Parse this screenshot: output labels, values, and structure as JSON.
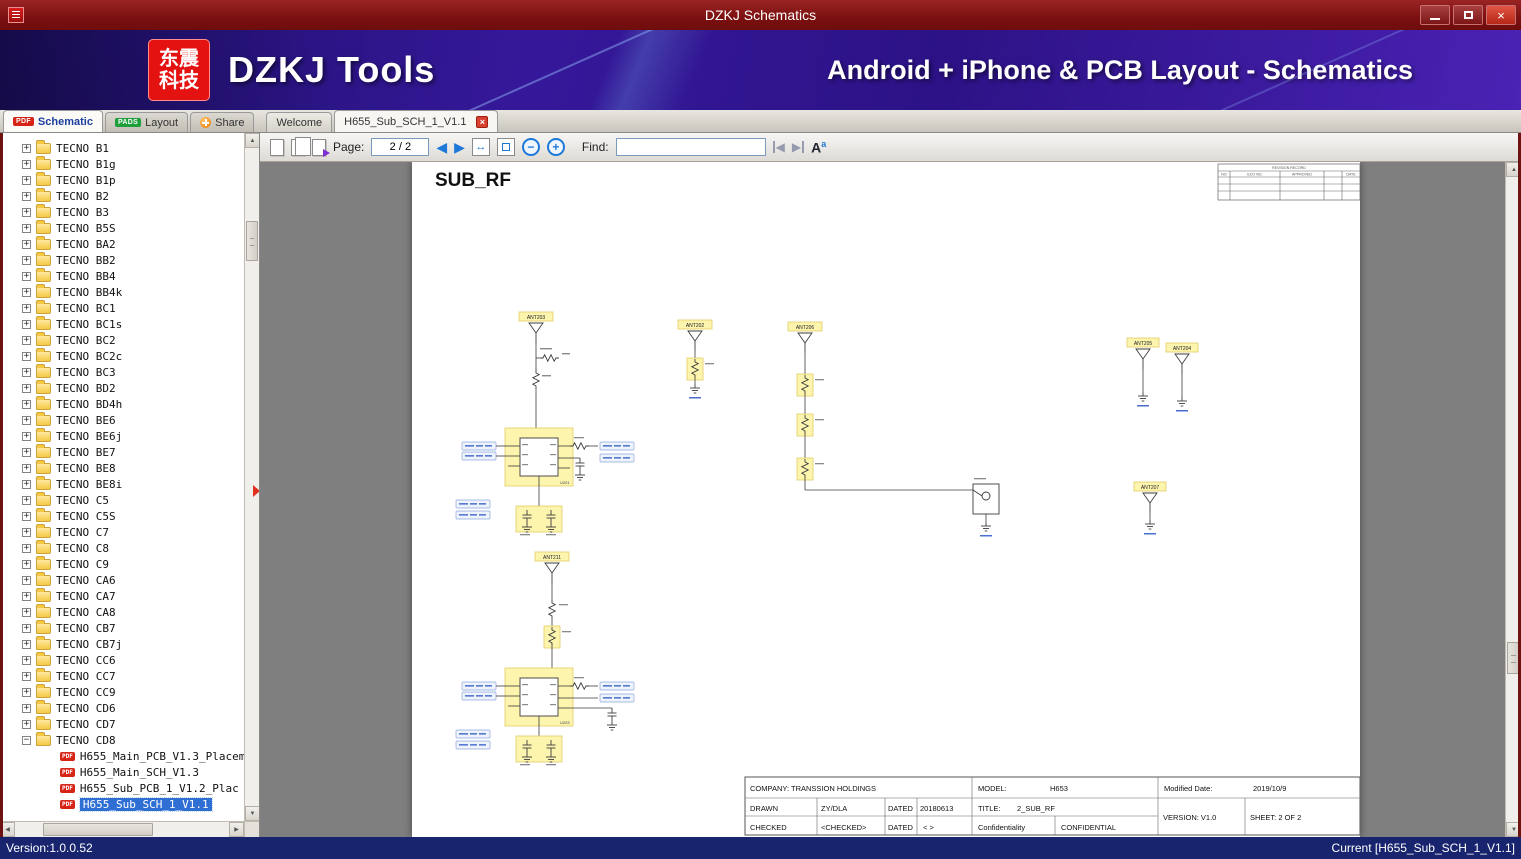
{
  "window": {
    "title": "DZKJ Schematics",
    "close_glyph": "×"
  },
  "banner": {
    "logo_line1": "东震",
    "logo_line2": "科技",
    "app_title": "DZKJ Tools",
    "subtitle": "Android + iPhone & PCB Layout - Schematics"
  },
  "tabs": {
    "pdf_badge": "PDF",
    "schematic": "Schematic",
    "pads_badge": "PADS",
    "layout": "Layout",
    "share": "Share",
    "welcome": "Welcome",
    "document": "H655_Sub_SCH_1_V1.1",
    "close_icon": "×"
  },
  "toolbar": {
    "page_label": "Page:",
    "page_value": "2 / 2",
    "prev_icon": "◀",
    "next_icon": "▶",
    "fit_width_icon": "↔",
    "zoom_out_icon": "−",
    "zoom_in_icon": "+",
    "find_label": "Find:",
    "find_value": "",
    "find_prev_icon": "◀",
    "find_next_icon": "▶",
    "font_icon_large": "A",
    "font_icon_small": "a"
  },
  "icons": {
    "arrow_up": "▲",
    "arrow_down": "▼",
    "arrow_left": "◀",
    "arrow_right": "▶"
  },
  "sidebar": {
    "expand_icon": "+",
    "collapse_icon": "−",
    "pdf_icon": "PDF",
    "folders": [
      {
        "label": "TECNO B1"
      },
      {
        "label": "TECNO B1g"
      },
      {
        "label": "TECNO B1p"
      },
      {
        "label": "TECNO B2"
      },
      {
        "label": "TECNO B3"
      },
      {
        "label": "TECNO B5S"
      },
      {
        "label": "TECNO BA2"
      },
      {
        "label": "TECNO BB2"
      },
      {
        "label": "TECNO BB4"
      },
      {
        "label": "TECNO BB4k"
      },
      {
        "label": "TECNO BC1"
      },
      {
        "label": "TECNO BC1s"
      },
      {
        "label": "TECNO BC2"
      },
      {
        "label": "TECNO BC2c"
      },
      {
        "label": "TECNO BC3"
      },
      {
        "label": "TECNO BD2"
      },
      {
        "label": "TECNO BD4h"
      },
      {
        "label": "TECNO BE6"
      },
      {
        "label": "TECNO BE6j"
      },
      {
        "label": "TECNO BE7"
      },
      {
        "label": "TECNO BE8"
      },
      {
        "label": "TECNO BE8i"
      },
      {
        "label": "TECNO C5"
      },
      {
        "label": "TECNO C5S"
      },
      {
        "label": "TECNO C7"
      },
      {
        "label": "TECNO C8"
      },
      {
        "label": "TECNO C9"
      },
      {
        "label": "TECNO CA6"
      },
      {
        "label": "TECNO CA7"
      },
      {
        "label": "TECNO CA8"
      },
      {
        "label": "TECNO CB7"
      },
      {
        "label": "TECNO CB7j"
      },
      {
        "label": "TECNO CC6"
      },
      {
        "label": "TECNO CC7"
      },
      {
        "label": "TECNO CC9"
      },
      {
        "label": "TECNO CD6"
      },
      {
        "label": "TECNO CD7"
      },
      {
        "label": "TECNO CD8",
        "expanded": true,
        "children": [
          {
            "label": "H655_Main_PCB_V1.3_Placem"
          },
          {
            "label": "H655_Main_SCH_V1.3"
          },
          {
            "label": "H655_Sub_PCB_1_V1.2_Plac"
          },
          {
            "label": "H655_Sub_SCH_1_V1.1",
            "selected": true
          }
        ]
      }
    ]
  },
  "schematic": {
    "page_title": "SUB_RF",
    "labels": {
      "ant202": "ANT202",
      "ant203": "ANT203",
      "ant204": "ANT204",
      "ant205": "ANT205",
      "ant206": "ANT206",
      "ant207": "ANT207",
      "ant211": "ANT211",
      "u201": "U201",
      "u203": "U203"
    },
    "revision": {
      "title": "REVISION RECORD",
      "col_no": "NO",
      "col_eco": "ECO NO.",
      "col_approved": "APPROVED",
      "col_date": "DATE"
    },
    "title_block": {
      "company": "COMPANY: TRANSSION HOLDINGS",
      "model_label": "MODEL:",
      "model_value": "H653",
      "modified_label": "Modified Date:",
      "modified_value": "2019/10/9",
      "drawn_label": "DRAWN",
      "drawn_value": "ZY/DLA",
      "dated_label": "DATED",
      "dated_value": "20180613",
      "title_label": "TITLE:",
      "title_value": "2_SUB_RF",
      "version": "VERSION: V1.0",
      "sheet": "SHEET:  2   OF    2",
      "checked_label": "CHECKED",
      "checked_value": "<CHECKED>",
      "dated2_label": "DATED",
      "dated2_value": "<  >",
      "conf_label": "Confidentiality",
      "conf_value": "CONFIDENTIAL"
    }
  },
  "statusbar": {
    "version": "Version:1.0.0.52",
    "current": "Current [H655_Sub_SCH_1_V1.1]"
  }
}
